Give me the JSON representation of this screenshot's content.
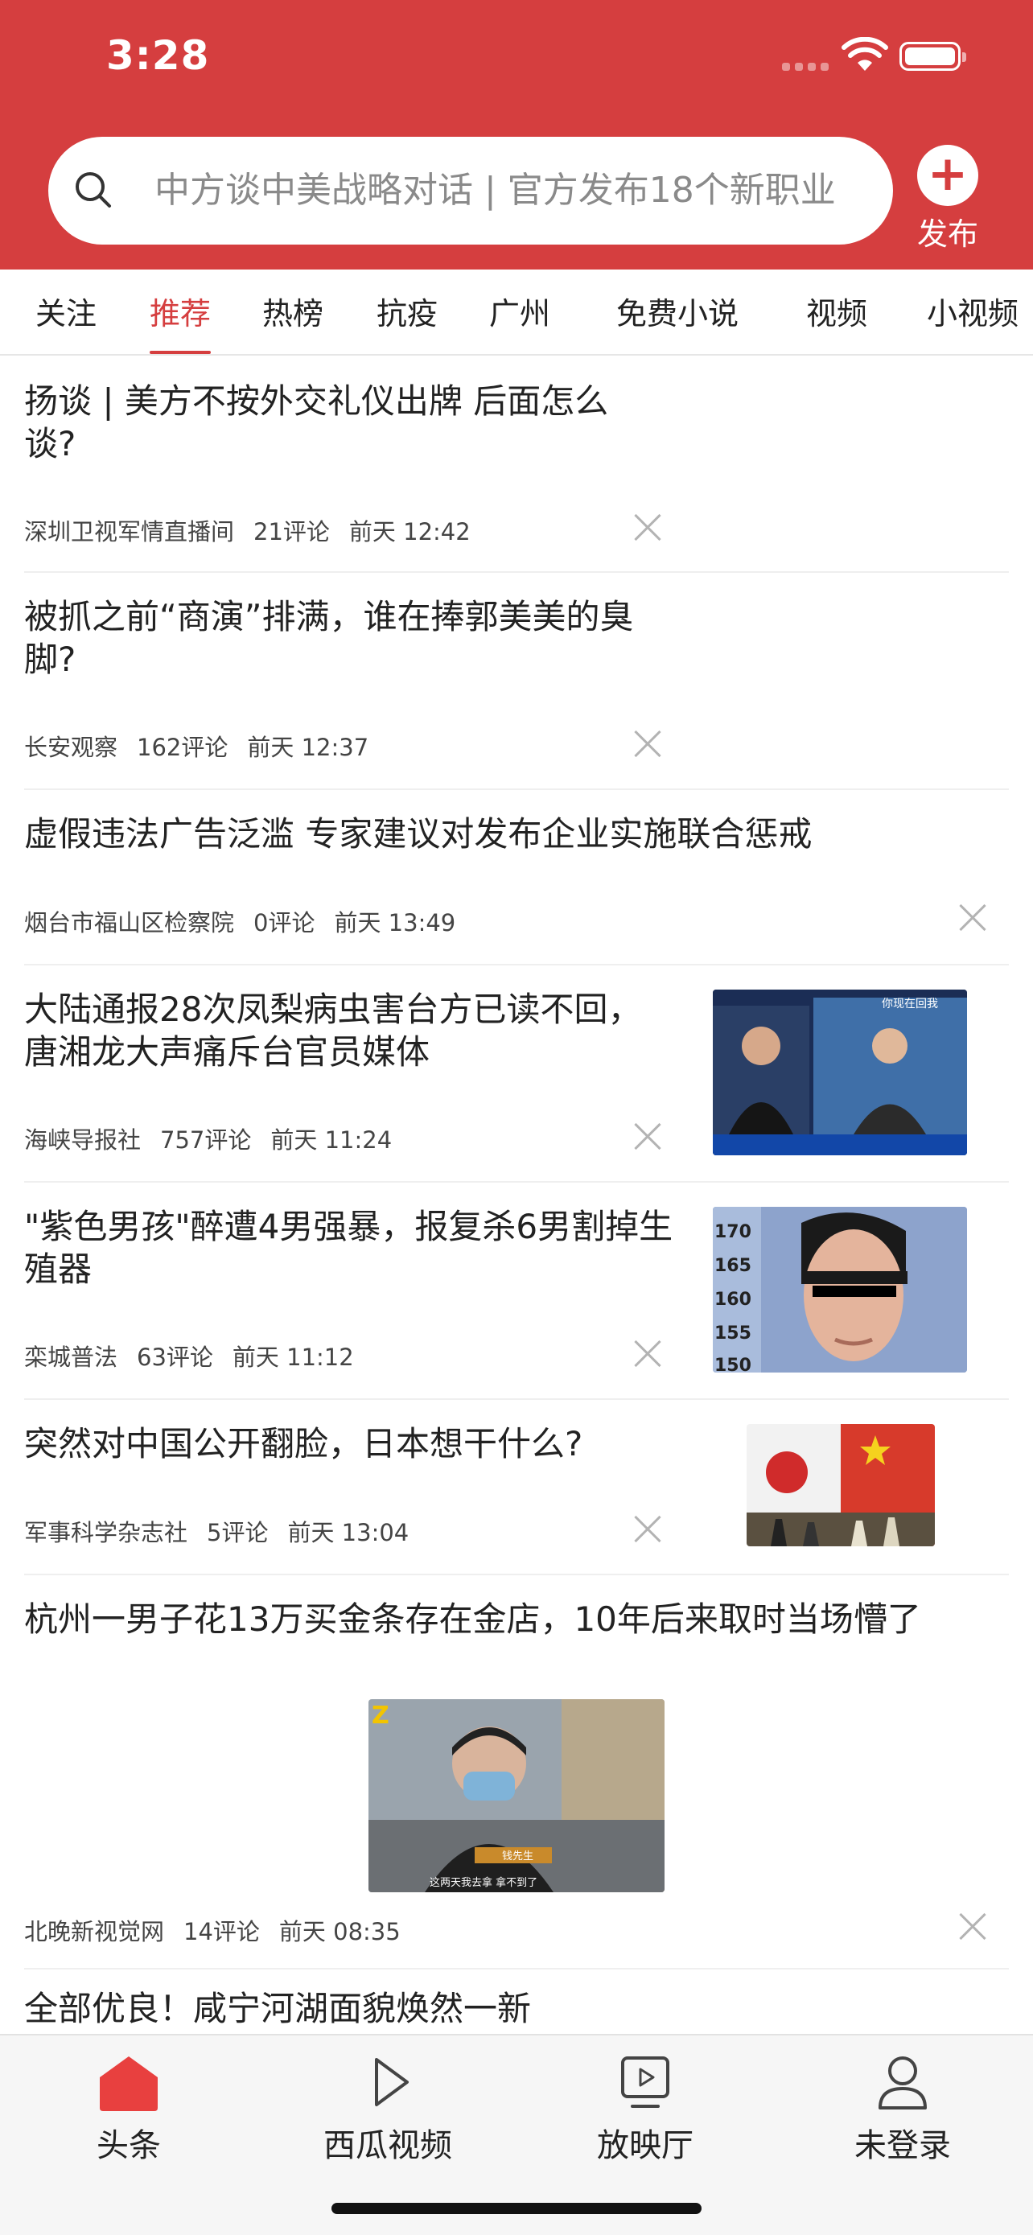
{
  "status_bar": {
    "time": "3:28"
  },
  "search": {
    "placeholder": "中方谈中美战略对话 | 官方发布18个新职业"
  },
  "publish": {
    "label": "发布"
  },
  "tabs": [
    {
      "label": "关注",
      "active": false
    },
    {
      "label": "推荐",
      "active": true
    },
    {
      "label": "热榜",
      "active": false
    },
    {
      "label": "抗疫",
      "active": false
    },
    {
      "label": "广州",
      "active": false
    },
    {
      "label": "免费小说",
      "active": false
    },
    {
      "label": "视频",
      "active": false
    },
    {
      "label": "小视频",
      "active": false
    }
  ],
  "feed": [
    {
      "title": "扬谈 | 美方不按外交礼仪出牌 后面怎么谈?",
      "source": "深圳卫视军情直播间",
      "comments": "21评论",
      "time": "前天 12:42"
    },
    {
      "title": "被抓之前“商演”排满，谁在捧郭美美的臭脚?",
      "source": "长安观察",
      "comments": "162评论",
      "time": "前天 12:37"
    },
    {
      "title": "虚假违法广告泛滥 专家建议对发布企业实施联合惩戒",
      "source": "烟台市福山区检察院",
      "comments": "0评论",
      "time": "前天 13:49"
    },
    {
      "title": "大陆通报28次凤梨病虫害台方已读不回，唐湘龙大声痛斥台官员媒体",
      "source": "海峡导报社",
      "comments": "757评论",
      "time": "前天 11:24",
      "image_caption": "你现在回我"
    },
    {
      "title": "\"紫色男孩\"醉遭4男强暴，报复杀6男割掉生殖器",
      "source": "栾城普法",
      "comments": "63评论",
      "time": "前天 11:12",
      "height_marks": [
        "170",
        "165",
        "160",
        "155",
        "150"
      ]
    },
    {
      "title": "突然对中国公开翻脸，日本想干什么?",
      "source": "军事科学杂志社",
      "comments": "5评论",
      "time": "前天 13:04"
    },
    {
      "title": "杭州一男子花13万买金条存在金店，10年后来取时当场懵了",
      "source": "北晚新视觉网",
      "comments": "14评论",
      "time": "前天 08:35",
      "image_name": "钱先生",
      "image_caption": "这两天我去拿 拿不到了"
    },
    {
      "title": "全部优良！咸宁河湖面貌焕然一新"
    }
  ],
  "bottom_tabs": [
    {
      "label": "头条",
      "icon": "home-icon",
      "active": true
    },
    {
      "label": "西瓜视频",
      "icon": "play-icon",
      "active": false
    },
    {
      "label": "放映厅",
      "icon": "screen-icon",
      "active": false
    },
    {
      "label": "未登录",
      "icon": "user-icon",
      "active": false
    }
  ],
  "colors": {
    "brand_red": "#d53e3f"
  }
}
